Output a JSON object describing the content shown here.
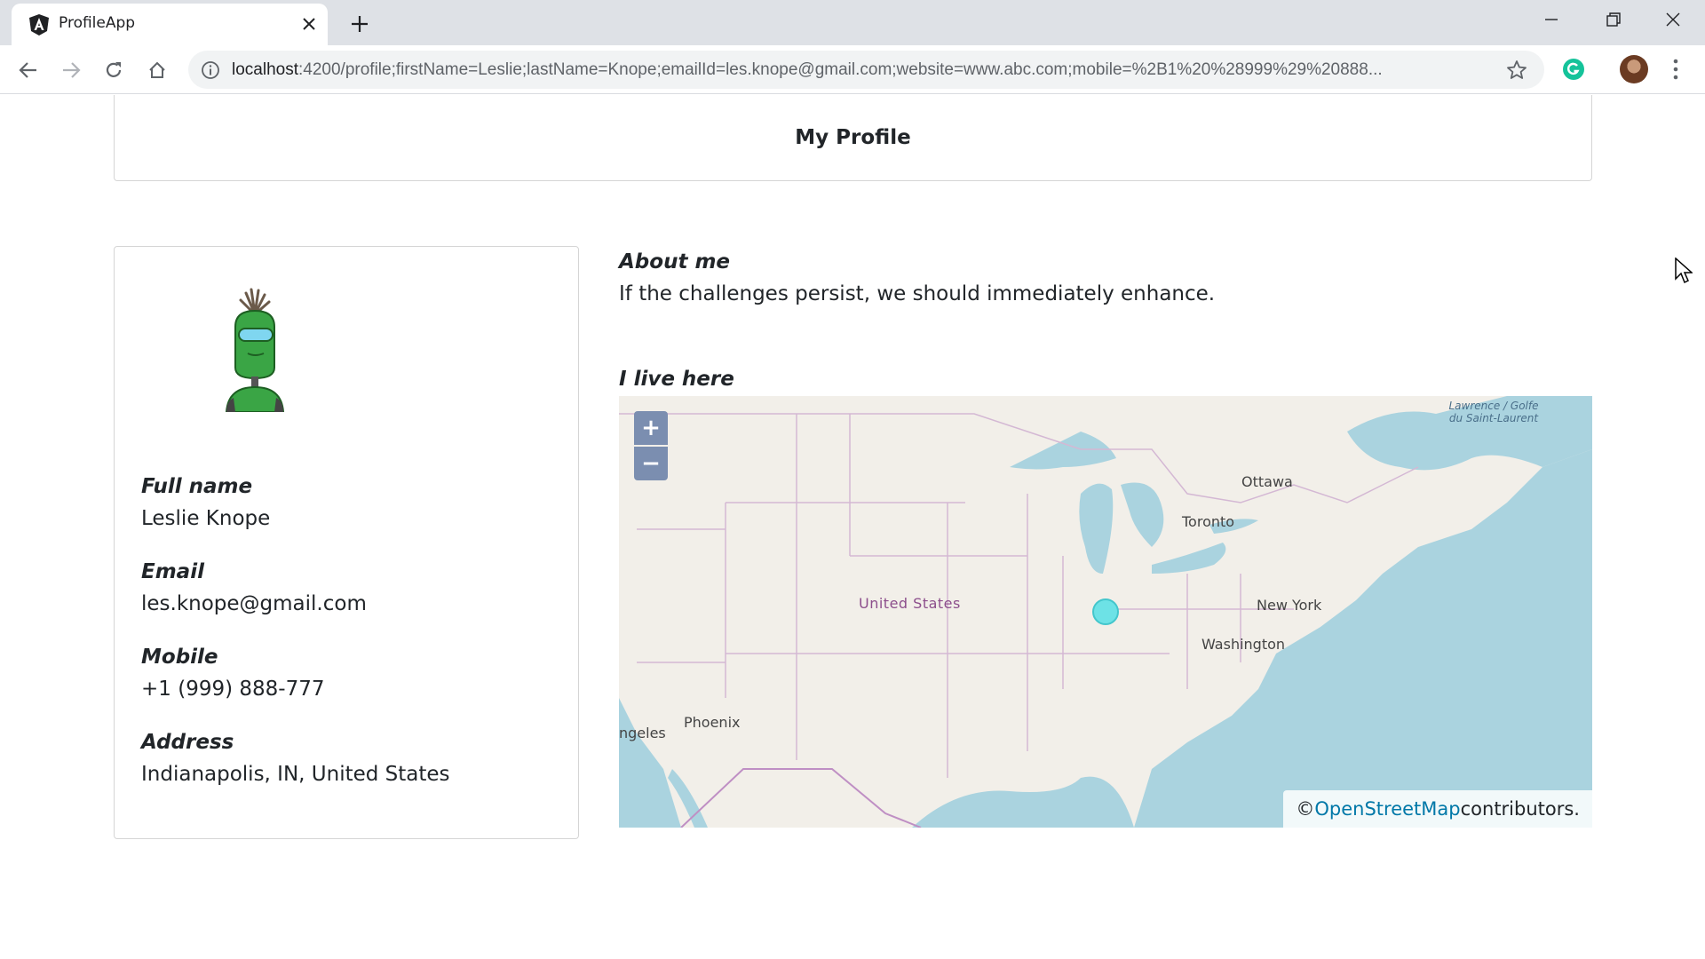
{
  "browser": {
    "tab_title": "ProfileApp",
    "url_host": "localhost",
    "url_rest": ":4200/profile;firstName=Leslie;lastName=Knope;emailId=les.knope@gmail.com;website=www.abc.com;mobile=%2B1%20%28999%29%20888..."
  },
  "page": {
    "title": "My Profile"
  },
  "profile": {
    "avatar": "robot-avatar",
    "fields": [
      {
        "label": "Full name",
        "value": "Leslie Knope"
      },
      {
        "label": "Email",
        "value": "les.knope@gmail.com"
      },
      {
        "label": "Mobile",
        "value": "+1 (999) 888-777"
      },
      {
        "label": "Address",
        "value": "Indianapolis, IN, United States"
      }
    ]
  },
  "about": {
    "label": "About me",
    "text": "If the challenges persist, we should immediately enhance."
  },
  "map": {
    "label": "I live here",
    "zoom_in": "+",
    "zoom_out": "−",
    "attribution_prefix": "© ",
    "attribution_link": "OpenStreetMap",
    "attribution_suffix": " contributors.",
    "places": {
      "ottawa": "Ottawa",
      "toronto": "Toronto",
      "new_york": "New York",
      "washington": "Washington",
      "united_states": "United States",
      "phoenix": "Phoenix",
      "los_angeles": "ngeles",
      "saint_laurent": "Lawrence / Golfe du Saint-Laurent"
    },
    "colors": {
      "water": "#aad3df",
      "land": "#f2efe9",
      "marker": "#6de2e6"
    }
  }
}
